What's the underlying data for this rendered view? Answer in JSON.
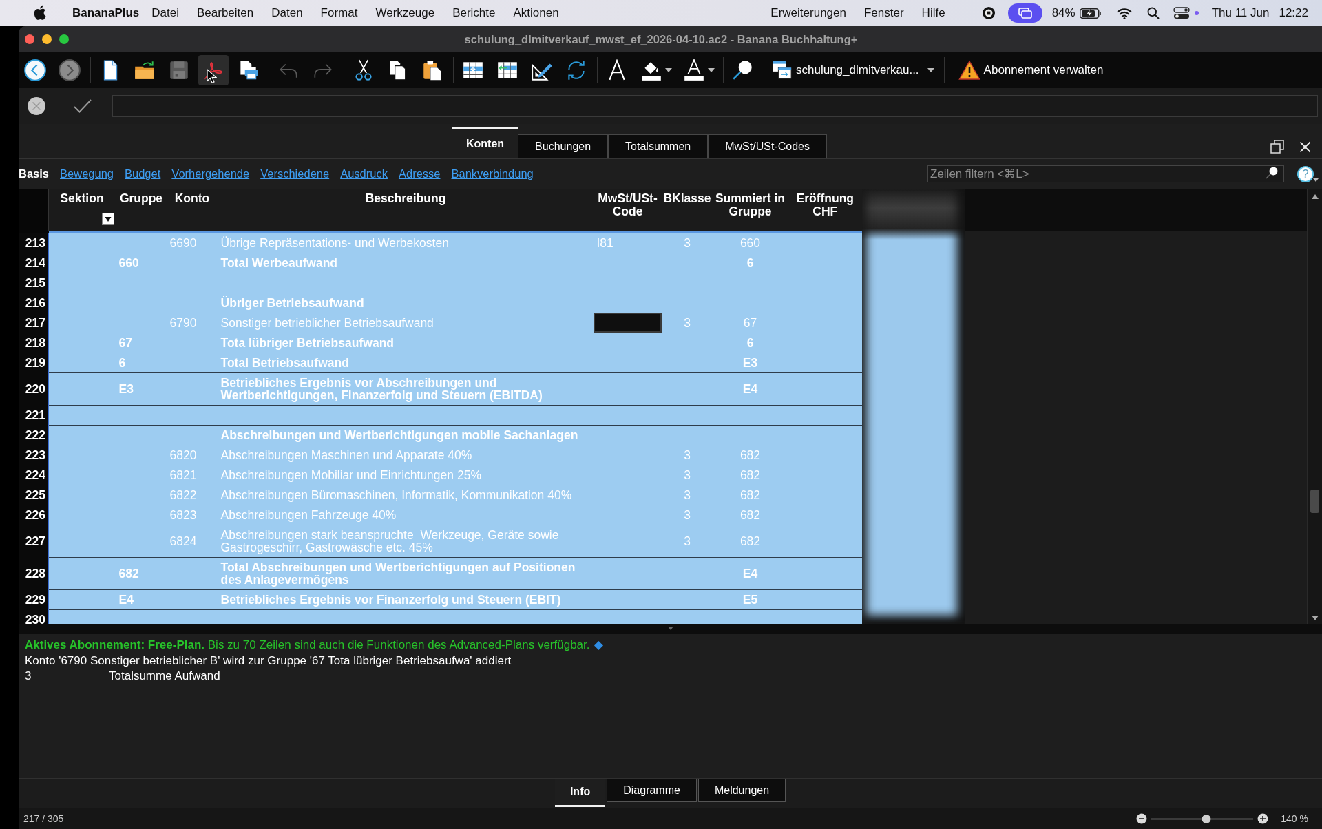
{
  "menu_bar": {
    "app_name": "BananaPlus",
    "menus": [
      "Datei",
      "Bearbeiten",
      "Daten",
      "Format",
      "Werkzeuge",
      "Berichte",
      "Aktionen"
    ],
    "extra_menus": [
      "Erweiterungen",
      "Fenster",
      "Hilfe"
    ],
    "battery": "84%",
    "date": "Thu 11 Jun",
    "time": "12:22"
  },
  "window": {
    "title": "schulung_dlmitverkauf_mwst_ef_2026-04-10.ac2 - Banana Buchhaltung+"
  },
  "toolbar": {
    "groups": [
      [
        {
          "kind": "back",
          "disabled": false,
          "hovered": false
        },
        {
          "kind": "forward",
          "disabled": true,
          "hovered": false
        }
      ],
      [
        {
          "kind": "new",
          "disabled": false,
          "hovered": false
        },
        {
          "kind": "open",
          "disabled": false,
          "hovered": false
        },
        {
          "kind": "save",
          "disabled": true,
          "hovered": false
        },
        {
          "kind": "pdf",
          "disabled": false,
          "hovered": true
        },
        {
          "kind": "print",
          "disabled": false,
          "hovered": false
        }
      ],
      [
        {
          "kind": "undo",
          "disabled": true,
          "hovered": false
        },
        {
          "kind": "redo",
          "disabled": true,
          "hovered": false
        }
      ],
      [
        {
          "kind": "cut",
          "disabled": false,
          "hovered": false
        },
        {
          "kind": "copy",
          "disabled": false,
          "hovered": false
        },
        {
          "kind": "paste",
          "disabled": false,
          "hovered": false
        }
      ],
      [
        {
          "kind": "insert",
          "disabled": false,
          "hovered": false
        },
        {
          "kind": "move",
          "disabled": false,
          "hovered": false
        },
        {
          "kind": "edit",
          "disabled": false,
          "hovered": false
        },
        {
          "kind": "refresh",
          "disabled": false,
          "hovered": false
        }
      ],
      [
        {
          "kind": "font",
          "disabled": false,
          "hovered": false
        },
        {
          "kind": "fill",
          "disabled": false,
          "hovered": false
        },
        {
          "kind": "color",
          "disabled": false,
          "hovered": false
        }
      ],
      [
        {
          "kind": "search",
          "disabled": false,
          "hovered": false
        }
      ]
    ],
    "file_selector": "schulung_dlmitverkau...",
    "subscription_button": "Abonnement verwalten"
  },
  "table_tabs": [
    {
      "label": "Konten",
      "selected": true
    },
    {
      "label": "Buchungen",
      "selected": false
    },
    {
      "label": "Totalsummen",
      "selected": false
    },
    {
      "label": "MwSt/USt-Codes",
      "selected": false
    }
  ],
  "views": [
    {
      "label": "Basis",
      "selected": true
    },
    {
      "label": "Bewegung",
      "selected": false
    },
    {
      "label": "Budget",
      "selected": false
    },
    {
      "label": "Vorhergehende",
      "selected": false
    },
    {
      "label": "Verschiedene",
      "selected": false
    },
    {
      "label": "Ausdruck",
      "selected": false
    },
    {
      "label": "Adresse",
      "selected": false
    },
    {
      "label": "Bankverbindung",
      "selected": false
    }
  ],
  "filter": {
    "placeholder": "Zeilen filtern <⌘L>"
  },
  "help_button": "?",
  "table": {
    "columns": [
      {
        "label": "Sektion",
        "filter_button": true,
        "selected": false
      },
      {
        "label": "Gruppe",
        "filter_button": false,
        "selected": false
      },
      {
        "label": "Konto",
        "filter_button": false,
        "selected": false
      },
      {
        "label": "Beschreibung",
        "filter_button": false,
        "selected": false
      },
      {
        "label": "MwSt/USt-Code",
        "filter_button": false,
        "selected": true
      },
      {
        "label": "BKlasse",
        "filter_button": false,
        "selected": false
      },
      {
        "label": "Summiert in Gruppe",
        "filter_button": false,
        "selected": false
      },
      {
        "label": "Eröffnung CHF",
        "filter_button": false,
        "selected": false
      }
    ],
    "rows": [
      {
        "number": "213",
        "kind": "account",
        "selected": false,
        "konto": "6690",
        "beschreibung": "Übrige Repräsentations- und Werbekosten",
        "mwst_code": "I81",
        "bklasse": "3",
        "summiert_in_gruppe": "660"
      },
      {
        "number": "214",
        "kind": "total",
        "selected": false,
        "gruppe": "660",
        "beschreibung": "Total Werbeaufwand",
        "summiert_in_gruppe": "6"
      },
      {
        "number": "215",
        "selected": false
      },
      {
        "number": "216",
        "kind": "heading",
        "selected": false,
        "beschreibung": "Übriger Betriebsaufwand"
      },
      {
        "number": "217",
        "kind": "account",
        "selected": true,
        "konto": "6790",
        "beschreibung": "Sonstiger betrieblicher Betriebsaufwand",
        "bklasse": "3",
        "summiert_in_gruppe": "67"
      },
      {
        "number": "218",
        "kind": "total",
        "selected": false,
        "gruppe": "67",
        "beschreibung": "Tota lübriger Betriebsaufwand",
        "summiert_in_gruppe": "6"
      },
      {
        "number": "219",
        "kind": "total",
        "selected": false,
        "gruppe": "6",
        "beschreibung": "Total Betriebsaufwand",
        "summiert_in_gruppe": "E3"
      },
      {
        "number": "220",
        "kind": "total",
        "selected": false,
        "gruppe": "E3",
        "beschreibung": "Betriebliches Ergebnis vor Abschreibungen und Wertberichtigungen, Finanzerfolg und Steuern (EBITDA)",
        "summiert_in_gruppe": "E4"
      },
      {
        "number": "221",
        "selected": false
      },
      {
        "number": "222",
        "kind": "heading",
        "selected": false,
        "beschreibung": "Abschreibungen und Wertberichtigungen mobile Sachanlagen"
      },
      {
        "number": "223",
        "kind": "account",
        "selected": false,
        "konto": "6820",
        "beschreibung": "Abschreibungen Maschinen und Apparate 40%",
        "bklasse": "3",
        "summiert_in_gruppe": "682"
      },
      {
        "number": "224",
        "kind": "account",
        "selected": false,
        "konto": "6821",
        "beschreibung": "Abschreibungen Mobiliar und Einrichtungen 25%",
        "bklasse": "3",
        "summiert_in_gruppe": "682"
      },
      {
        "number": "225",
        "kind": "account",
        "selected": false,
        "konto": "6822",
        "beschreibung": "Abschreibungen Büromaschinen, Informatik, Kommunikation 40%",
        "bklasse": "3",
        "summiert_in_gruppe": "682"
      },
      {
        "number": "226",
        "kind": "account",
        "selected": false,
        "konto": "6823",
        "beschreibung": "Abschreibungen Fahrzeuge 40%",
        "bklasse": "3",
        "summiert_in_gruppe": "682"
      },
      {
        "number": "227",
        "kind": "account",
        "selected": false,
        "konto": "6824",
        "beschreibung": "Abschreibungen stark beanspruchte  Werkzeuge, Geräte sowie Gastrogeschirr, Gastrowäsche etc. 45%",
        "bklasse": "3",
        "summiert_in_gruppe": "682"
      },
      {
        "number": "228",
        "kind": "total",
        "selected": false,
        "gruppe": "682",
        "beschreibung": "Total Abschreibungen und Wertberichtigungen auf Positionen des Anlagevermögens",
        "summiert_in_gruppe": "E4"
      },
      {
        "number": "229",
        "kind": "total",
        "selected": false,
        "gruppe": "E4",
        "beschreibung": "Betriebliches Ergebnis vor Finanzerfolg und Steuern (EBIT)",
        "summiert_in_gruppe": "E5"
      },
      {
        "number": "230",
        "selected": false
      }
    ]
  },
  "info": {
    "notice": "**Aktives Abonnement: Free-Plan.** Bis zu 70 Zeilen sind auch die Funktionen des Advanced-Plans verfügbar.",
    "message": "Konto '6790 Sonstiger betrieblicher B' wird zur Gruppe '67 Tota lübriger Betriebsaufwa' addiert",
    "detail": [
      "3",
      "Totalsumme Aufwand"
    ]
  },
  "panel_tabs": [
    {
      "label": "Info",
      "selected": true
    },
    {
      "label": "Diagramme",
      "selected": false
    },
    {
      "label": "Meldungen",
      "selected": false
    }
  ],
  "status_bar": {
    "position": "217 / 305",
    "zoom": {
      "level": 0.54,
      "reading": "140 %"
    }
  }
}
